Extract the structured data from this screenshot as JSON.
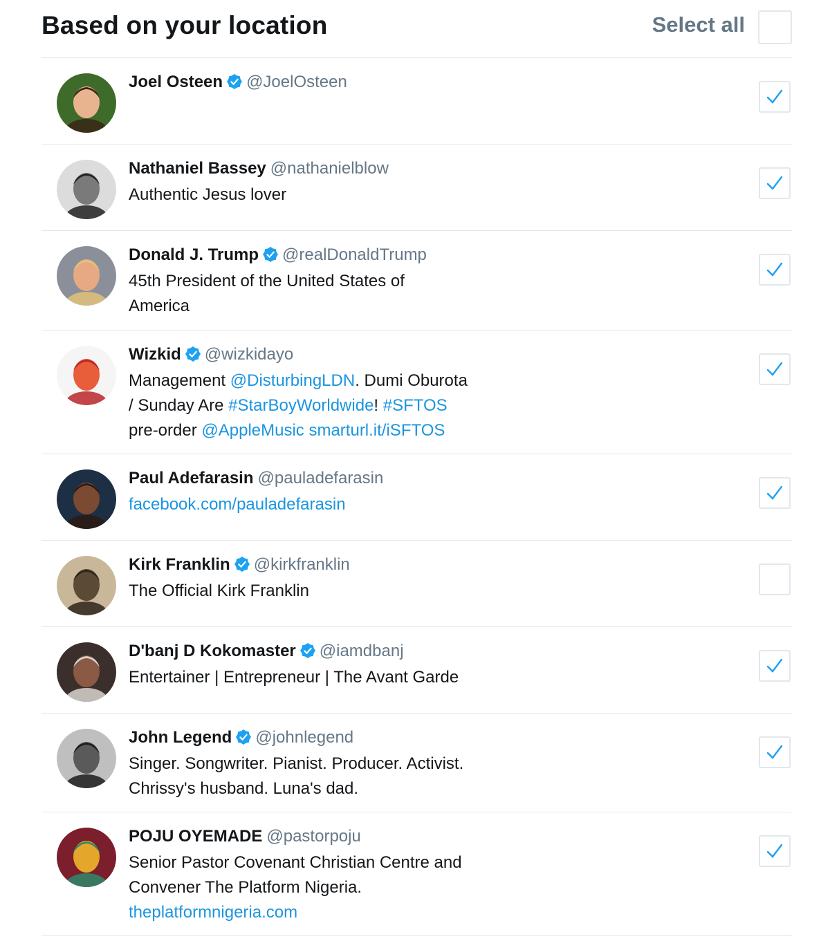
{
  "header": {
    "title": "Based on your location",
    "select_all_label": "Select all",
    "select_all_checked": false
  },
  "colors": {
    "accent": "#1da1f2",
    "link": "#1b95e0",
    "secondary_text": "#657786",
    "divider": "#e1e8ed"
  },
  "accounts": [
    {
      "name": "Joel Osteen",
      "verified": true,
      "handle": "@JoelOsteen",
      "checked": true,
      "bio": []
    },
    {
      "name": "Nathaniel Bassey",
      "verified": false,
      "handle": "@nathanielblow",
      "checked": true,
      "bio": [
        [
          "Authentic Jesus lover"
        ]
      ]
    },
    {
      "name": "Donald J. Trump",
      "verified": true,
      "handle": "@realDonaldTrump",
      "checked": true,
      "bio": [
        [
          "45th President of the United States of"
        ],
        [
          "America"
        ]
      ]
    },
    {
      "name": "Wizkid",
      "verified": true,
      "handle": "@wizkidayo",
      "checked": true,
      "bio": [
        [
          "Management ",
          {
            "link": "@DisturbingLDN"
          },
          ". Dumi Oburota"
        ],
        [
          "/ Sunday Are ",
          {
            "link": "#StarBoyWorldwide"
          },
          "! ",
          {
            "link": "#SFTOS"
          }
        ],
        [
          "pre-order ",
          {
            "link": "@AppleMusic"
          },
          " ",
          {
            "link": "smarturl.it/iSFTOS"
          }
        ]
      ]
    },
    {
      "name": "Paul Adefarasin",
      "verified": false,
      "handle": "@pauladefarasin",
      "checked": true,
      "bio": [
        [
          {
            "link": "facebook.com/pauladefarasin"
          }
        ]
      ]
    },
    {
      "name": "Kirk Franklin",
      "verified": true,
      "handle": "@kirkfranklin",
      "checked": false,
      "bio": [
        [
          "The Official Kirk Franklin"
        ]
      ]
    },
    {
      "name": "D'banj D Kokomaster",
      "verified": true,
      "handle": "@iamdbanj",
      "checked": true,
      "bio": [
        [
          "Entertainer | Entrepreneur | The Avant Garde"
        ]
      ]
    },
    {
      "name": "John Legend",
      "verified": true,
      "handle": "@johnlegend",
      "checked": true,
      "bio": [
        [
          "Singer. Songwriter. Pianist. Producer. Activist."
        ],
        [
          "Chrissy's husband. Luna's dad."
        ]
      ]
    },
    {
      "name": "POJU OYEMADE",
      "verified": false,
      "handle": "@pastorpoju",
      "checked": true,
      "bio": [
        [
          "Senior Pastor Covenant Christian Centre and"
        ],
        [
          "Convener The Platform Nigeria."
        ],
        [
          {
            "link": "theplatformnigeria.com"
          }
        ]
      ]
    }
  ]
}
